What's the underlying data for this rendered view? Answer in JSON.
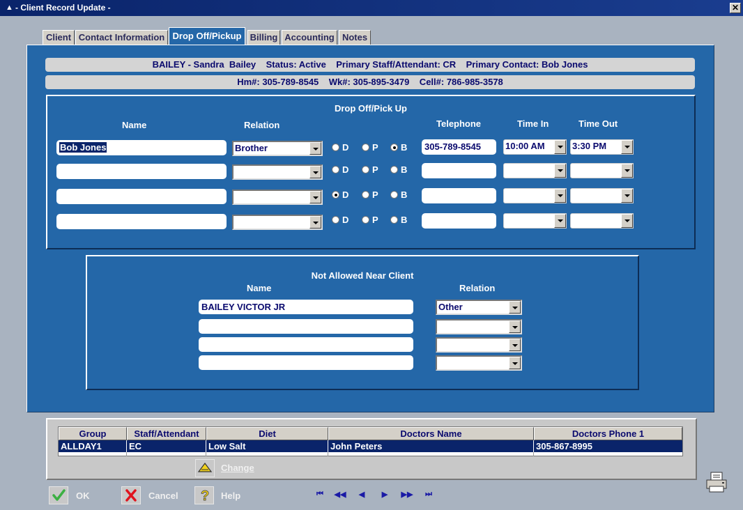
{
  "window": {
    "title": "- Client Record Update -",
    "close_glyph": "✕"
  },
  "tabs": [
    {
      "label": "Client"
    },
    {
      "label": "Contact Information"
    },
    {
      "label": "Drop Off/Pickup"
    },
    {
      "label": "Billing"
    },
    {
      "label": "Accounting"
    },
    {
      "label": "Notes"
    }
  ],
  "active_tab": "Drop Off/Pickup",
  "header": {
    "line1": "BAILEY - Sandra  Bailey    Status: Active    Primary Staff/Attendant: CR    Primary Contact: Bob Jones",
    "line2": "Hm#: 305-789-8545    Wk#: 305-895-3479    Cell#: 786-985-3578"
  },
  "dropoff": {
    "title": "Drop Off/Pick Up",
    "col_name": "Name",
    "col_relation": "Relation",
    "col_telephone": "Telephone",
    "col_time_in": "Time In",
    "col_time_out": "Time Out",
    "radio_labels": [
      "D",
      "P",
      "B"
    ],
    "rows": [
      {
        "name": "Bob Jones",
        "relation": "Brother",
        "mode": "B",
        "telephone": "305-789-8545",
        "time_in": "10:00 AM",
        "time_out": "3:30 PM"
      },
      {
        "name": "",
        "relation": "",
        "mode": "",
        "telephone": "",
        "time_in": "",
        "time_out": ""
      },
      {
        "name": "",
        "relation": "",
        "mode": "D",
        "telephone": "",
        "time_in": "",
        "time_out": ""
      },
      {
        "name": "",
        "relation": "",
        "mode": "",
        "telephone": "",
        "time_in": "",
        "time_out": ""
      }
    ]
  },
  "not_allowed": {
    "title": "Not Allowed Near Client",
    "col_name": "Name",
    "col_relation": "Relation",
    "rows": [
      {
        "name": "BAILEY VICTOR JR",
        "relation": "Other"
      },
      {
        "name": "",
        "relation": ""
      },
      {
        "name": "",
        "relation": ""
      },
      {
        "name": "",
        "relation": ""
      }
    ]
  },
  "grid": {
    "columns": [
      "Group",
      "Staff/Attendant",
      "Diet",
      "Doctors Name",
      "Doctors Phone 1"
    ],
    "rows": [
      [
        "ALLDAY1",
        "EC",
        "Low Salt",
        "John Peters",
        "305-867-8995"
      ]
    ]
  },
  "buttons": {
    "change": "Change",
    "ok": "OK",
    "cancel": "Cancel",
    "help": "Help"
  },
  "nav": {
    "first": "⏮",
    "prev_page": "◀◀",
    "prev": "◀",
    "next": "▶",
    "next_page": "▶▶",
    "last": "⏭"
  },
  "icons": {
    "title": "app-icon",
    "ok": "check-icon",
    "cancel": "x-icon",
    "help": "question-icon",
    "change": "triangle-up-icon",
    "print": "printer-icon"
  },
  "colors": {
    "panel": "#2467a8",
    "titlebar": "#0a246a",
    "selection": "#0a246a",
    "ok_check": "#3cb043",
    "cancel_x": "#e0141e",
    "help_q": "#f2d21b"
  }
}
